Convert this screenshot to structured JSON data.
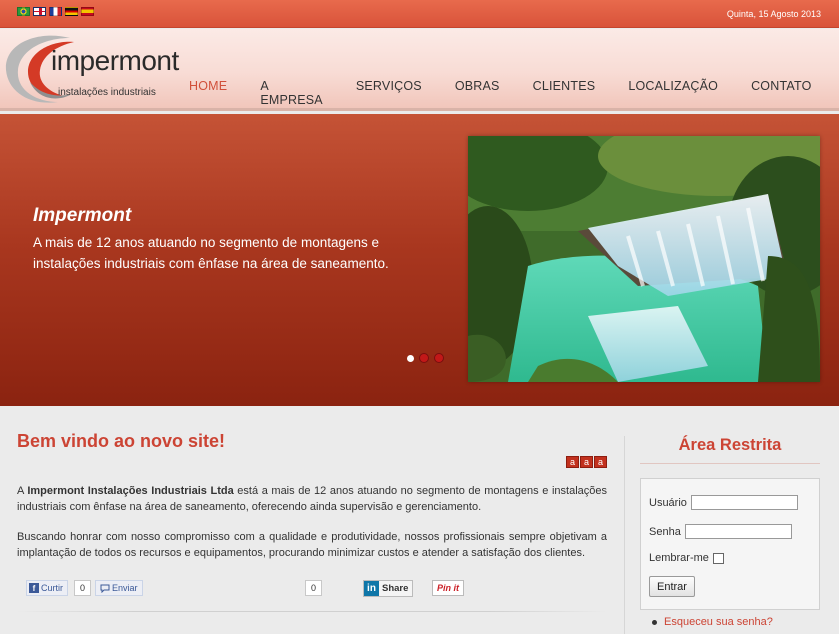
{
  "topbar": {
    "flags": [
      "brazil-flag",
      "uk-flag",
      "france-flag",
      "germany-flag",
      "spain-flag"
    ],
    "date": "Quinta, 15 Agosto 2013"
  },
  "logo": {
    "name": "impermont",
    "subtitle": "instalações industriais"
  },
  "nav": [
    "HOME",
    "A EMPRESA",
    "SERVIÇOS",
    "OBRAS",
    "CLIENTES",
    "LOCALIZAÇÃO",
    "CONTATO"
  ],
  "nav_active": "HOME",
  "hero": {
    "title": "Impermont",
    "text": "A mais de 12 anos atuando no segmento de montagens e instalações industriais com ênfase na área de saneamento.",
    "slides": 3,
    "active_slide": 1
  },
  "main": {
    "welcome": "Bem vindo ao novo site!",
    "font_controls": [
      "a",
      "a",
      "a"
    ],
    "para1_prefix": "A ",
    "company": "Impermont Instalações Industriais Ltda",
    "para1_rest": " está a mais de 12 anos atuando no segmento de montagens e instalações industriais com ênfase na área de saneamento, oferecendo ainda supervisão e gerenciamento.",
    "para2": "Buscando honrar com nosso compromisso com a qualidade e produtividade, nossos profissionais sempre objetivam a implantação de todos os recursos e equipamentos, procurando minimizar custos e atender a satisfação dos clientes."
  },
  "social": {
    "like_label": "Curtir",
    "like_count": "0",
    "send_label": "Enviar",
    "tweet_count": "0",
    "share_label": "Share",
    "pin_label": "Pin it"
  },
  "login": {
    "title": "Área Restrita",
    "user_label": "Usuário",
    "pass_label": "Senha",
    "remember_label": "Lembrar-me",
    "submit": "Entrar",
    "forgot": "Esqueceu sua senha?"
  },
  "colors": {
    "accent": "#cc4434",
    "hero": "#a9371f",
    "topbar": "#e0603f"
  }
}
